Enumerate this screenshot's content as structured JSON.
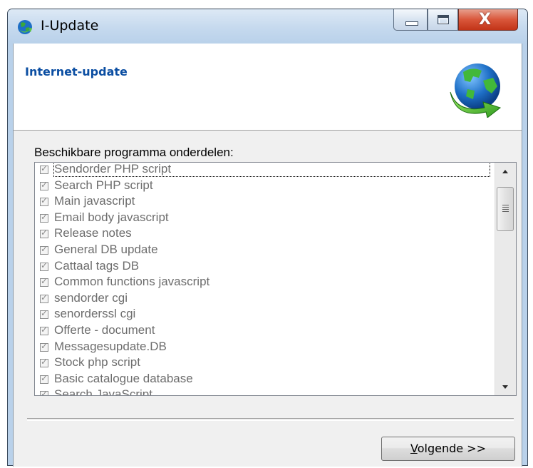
{
  "window": {
    "title": "I-Update",
    "close_glyph": "X"
  },
  "header": {
    "title": "Internet-update",
    "icon": "globe-update-icon"
  },
  "list": {
    "label": "Beschikbare programma onderdelen:",
    "items": [
      {
        "label": "Sendorder PHP script",
        "checked": true
      },
      {
        "label": "Search PHP script",
        "checked": true
      },
      {
        "label": "Main javascript",
        "checked": true
      },
      {
        "label": "Email body javascript",
        "checked": true
      },
      {
        "label": "Release notes",
        "checked": true
      },
      {
        "label": "General DB update",
        "checked": true
      },
      {
        "label": "Cattaal tags DB",
        "checked": true
      },
      {
        "label": "Common functions javascript",
        "checked": true
      },
      {
        "label": "sendorder cgi",
        "checked": true
      },
      {
        "label": "senorderssl cgi",
        "checked": true
      },
      {
        "label": "Offerte - document",
        "checked": true
      },
      {
        "label": "Messagesupdate.DB",
        "checked": true
      },
      {
        "label": "Stock php script",
        "checked": true
      },
      {
        "label": "Basic catalogue database",
        "checked": true
      },
      {
        "label": "Search JavaScript",
        "checked": true
      }
    ]
  },
  "buttons": {
    "next_mnemonic": "V",
    "next_rest": "olgende >>"
  },
  "colors": {
    "header_title": "#0b4ea2",
    "disabled_text": "#6d6d6d",
    "close_button": "#c23418"
  }
}
